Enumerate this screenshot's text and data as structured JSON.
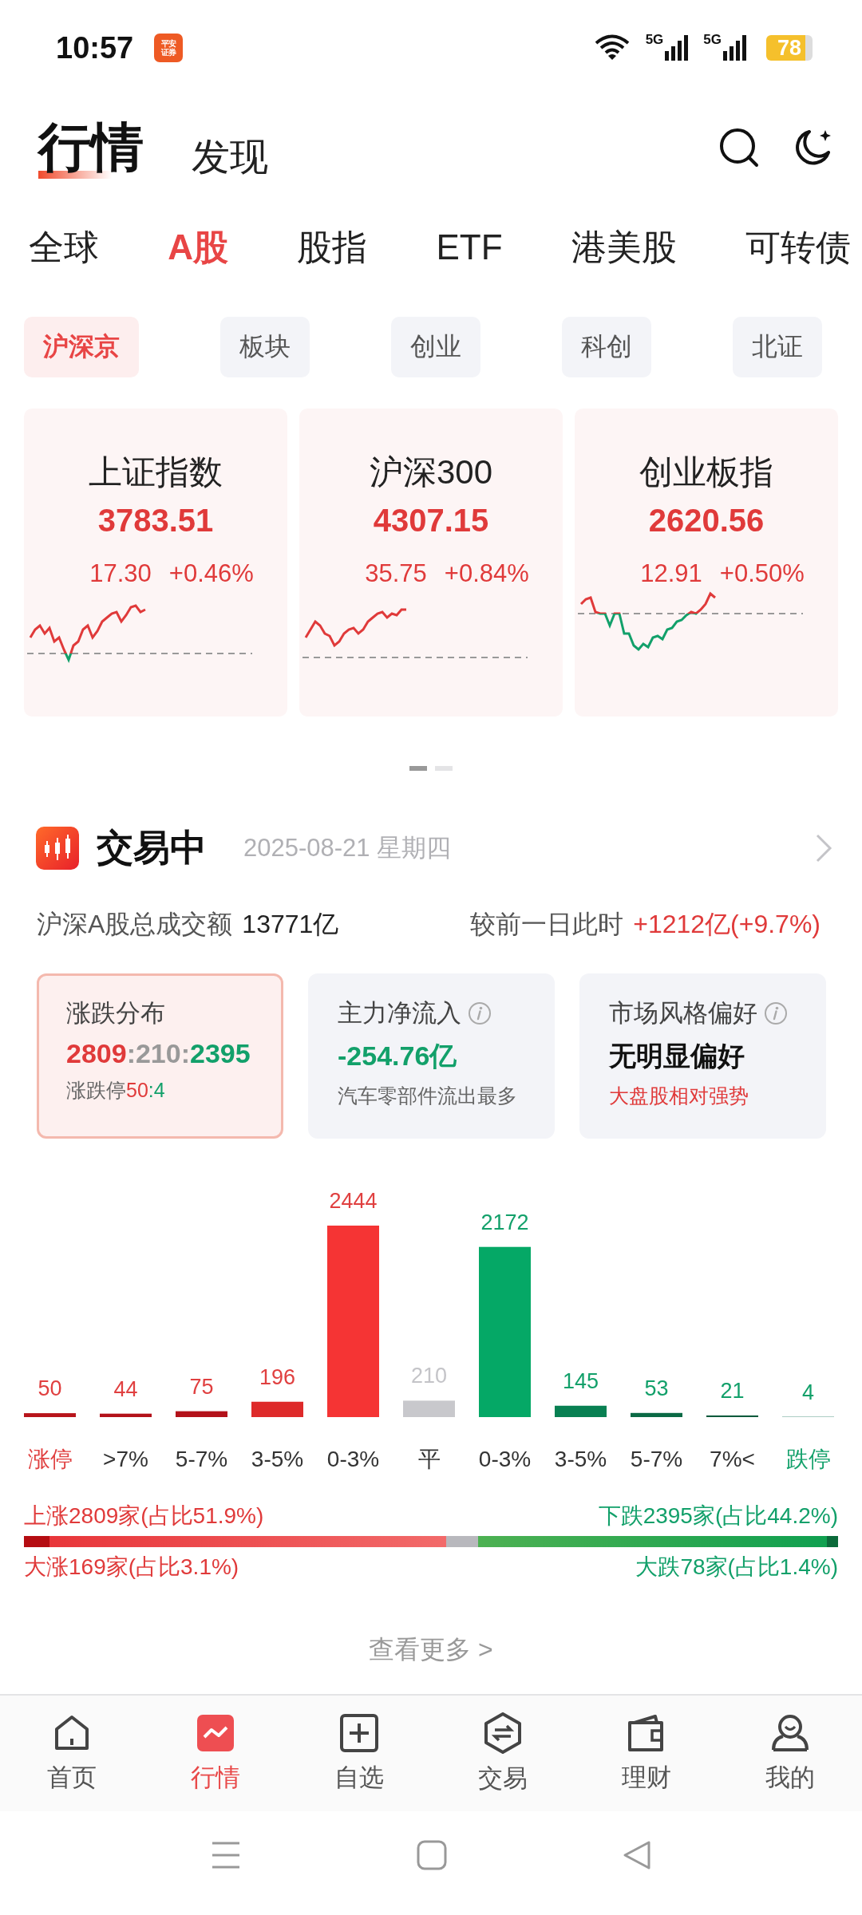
{
  "status_bar": {
    "time": "10:57",
    "app_badge": [
      "平安",
      "证券"
    ],
    "signals": [
      {
        "label": "5G"
      },
      {
        "label": "5G"
      }
    ],
    "battery": "78"
  },
  "header_tabs": [
    {
      "label": "行情",
      "selected": true
    },
    {
      "label": "发现",
      "selected": false
    }
  ],
  "market_tabs": [
    {
      "label": "全球",
      "selected": false
    },
    {
      "label": "A股",
      "selected": true
    },
    {
      "label": "股指",
      "selected": false
    },
    {
      "label": "ETF",
      "selected": false
    },
    {
      "label": "港美股",
      "selected": false
    },
    {
      "label": "可转债",
      "selected": false
    }
  ],
  "sub_tabs": [
    {
      "label": "沪深京",
      "selected": true
    },
    {
      "label": "板块",
      "selected": false
    },
    {
      "label": "创业",
      "selected": false
    },
    {
      "label": "科创",
      "selected": false
    },
    {
      "label": "北证",
      "selected": false
    }
  ],
  "index_cards": [
    {
      "name": "上证指数",
      "value": "3783.51",
      "change": "17.30",
      "percent": "+0.46%"
    },
    {
      "name": "沪深300",
      "value": "4307.15",
      "change": "35.75",
      "percent": "+0.84%"
    },
    {
      "name": "创业板指",
      "value": "2620.56",
      "change": "12.91",
      "percent": "+0.50%"
    }
  ],
  "pager_dots": [
    {
      "selected": true
    },
    {
      "selected": false
    }
  ],
  "trading": {
    "status": "交易中",
    "date": "2025-08-21 星期四",
    "turnover_label": "沪深A股总成交额",
    "turnover": "13771亿",
    "compare_label": "较前一日此时",
    "compare_value": "+1212亿(+9.7%)",
    "stat_cards": [
      {
        "title": "涨跌分布",
        "selected": true,
        "has_info": false,
        "value_parts": [
          {
            "text": "2809",
            "kind": "up"
          },
          {
            "text": ":210:",
            "kind": "flat"
          },
          {
            "text": "2395",
            "kind": "down"
          }
        ],
        "sub_label": "涨跌停",
        "sub_parts": [
          {
            "text": "50",
            "kind": "up"
          },
          {
            "text": ":4",
            "kind": "down"
          }
        ]
      },
      {
        "title": "主力净流入",
        "selected": false,
        "has_info": true,
        "value_parts": [
          {
            "text": "-254.76亿",
            "kind": "down"
          }
        ],
        "sub_parts": [
          {
            "text": "汽车零部件流出最多",
            "kind": "muted"
          }
        ]
      },
      {
        "title": "市场风格偏好",
        "selected": false,
        "has_info": true,
        "value_parts": [
          {
            "text": "无明显偏好",
            "kind": "plain"
          }
        ],
        "sub_parts": [
          {
            "text": "大盘股相对强势",
            "kind": "up"
          }
        ]
      }
    ],
    "distribution": {
      "chart_data": {
        "type": "bar",
        "categories": [
          "涨停",
          ">7%",
          "5-7%",
          "3-5%",
          "0-3%",
          "平",
          "0-3%",
          "3-5%",
          "5-7%",
          "7%<",
          "跌停"
        ],
        "values": [
          50,
          44,
          75,
          196,
          2444,
          210,
          2172,
          145,
          53,
          21,
          4
        ],
        "data_labels": true,
        "colors": [
          "#b8141b",
          "#b3121a",
          "#b3121a",
          "#de2a2a",
          "#f53434",
          "#c8c8cc",
          "#05a866",
          "#088052",
          "#0b6a45",
          "#0b5a3c",
          "#2f7f6a"
        ],
        "stacked": false
      }
    },
    "ratio": {
      "up_label": "上涨2809家(占比51.9%)",
      "down_label": "下跌2395家(占比44.2%)",
      "big_up_label": "大涨169家(占比3.1%)",
      "big_down_label": "大跌78家(占比1.4%)",
      "segments": [
        {
          "kind": "big_up"
        },
        {
          "kind": "up"
        },
        {
          "kind": "flat"
        },
        {
          "kind": "down"
        },
        {
          "kind": "big_down"
        }
      ]
    },
    "more_link": "查看更多 >"
  },
  "bottom_nav": [
    {
      "label": "首页",
      "kind": "home",
      "selected": false
    },
    {
      "label": "行情",
      "kind": "chart",
      "selected": true
    },
    {
      "label": "自选",
      "kind": "plus",
      "selected": false
    },
    {
      "label": "交易",
      "kind": "exchange",
      "selected": false
    },
    {
      "label": "理财",
      "kind": "wallet",
      "selected": false
    },
    {
      "label": "我的",
      "kind": "person",
      "selected": false
    }
  ]
}
